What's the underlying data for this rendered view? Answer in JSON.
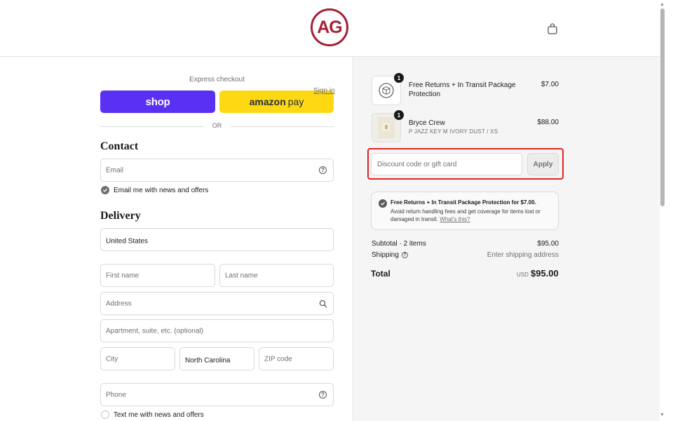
{
  "brand": {
    "logo_text": "AG",
    "accent": "#a51f36"
  },
  "header": {
    "cart_icon": "shopping-bag-icon"
  },
  "express": {
    "label": "Express checkout",
    "shop_label": "shop",
    "amazon_label": "amazon",
    "amazon_pay": "pay",
    "or_label": "OR"
  },
  "contact": {
    "title": "Contact",
    "signin_label": "Sign in",
    "email_placeholder": "Email",
    "newsletter_label": "Email me with news and offers",
    "newsletter_checked": true
  },
  "delivery": {
    "title": "Delivery",
    "country": "United States",
    "first_name_placeholder": "First name",
    "last_name_placeholder": "Last name",
    "address_placeholder": "Address",
    "apartment_placeholder": "Apartment, suite, etc. (optional)",
    "city_placeholder": "City",
    "state": "North Carolina",
    "zip_placeholder": "ZIP code",
    "phone_placeholder": "Phone",
    "sms_label": "Text me with news and offers",
    "sms_checked": false
  },
  "cart": {
    "items": [
      {
        "name": "Free Returns + In Transit Package Protection",
        "variant": "",
        "price": "$7.00",
        "qty": "1"
      },
      {
        "name": "Bryce Crew",
        "variant": "P JAZZ KEY M IVORY DUST / XS",
        "price": "$88.00",
        "qty": "1"
      }
    ],
    "discount_placeholder": "Discount code or gift card",
    "apply_label": "Apply",
    "protection": {
      "title": "Free Returns + In Transit Package Protection for $7.00.",
      "desc": "Avoid return handling fees and get coverage for items lost or damaged in transit.",
      "link": "What's this?"
    },
    "subtotal_label": "Subtotal · 2 items",
    "subtotal_value": "$95.00",
    "shipping_label": "Shipping",
    "shipping_value": "Enter shipping address",
    "total_label": "Total",
    "total_currency": "USD",
    "total_value": "$95.00"
  },
  "colors": {
    "shop": "#5a31f4",
    "amazon": "#ffd814",
    "highlight": "#e02424"
  }
}
